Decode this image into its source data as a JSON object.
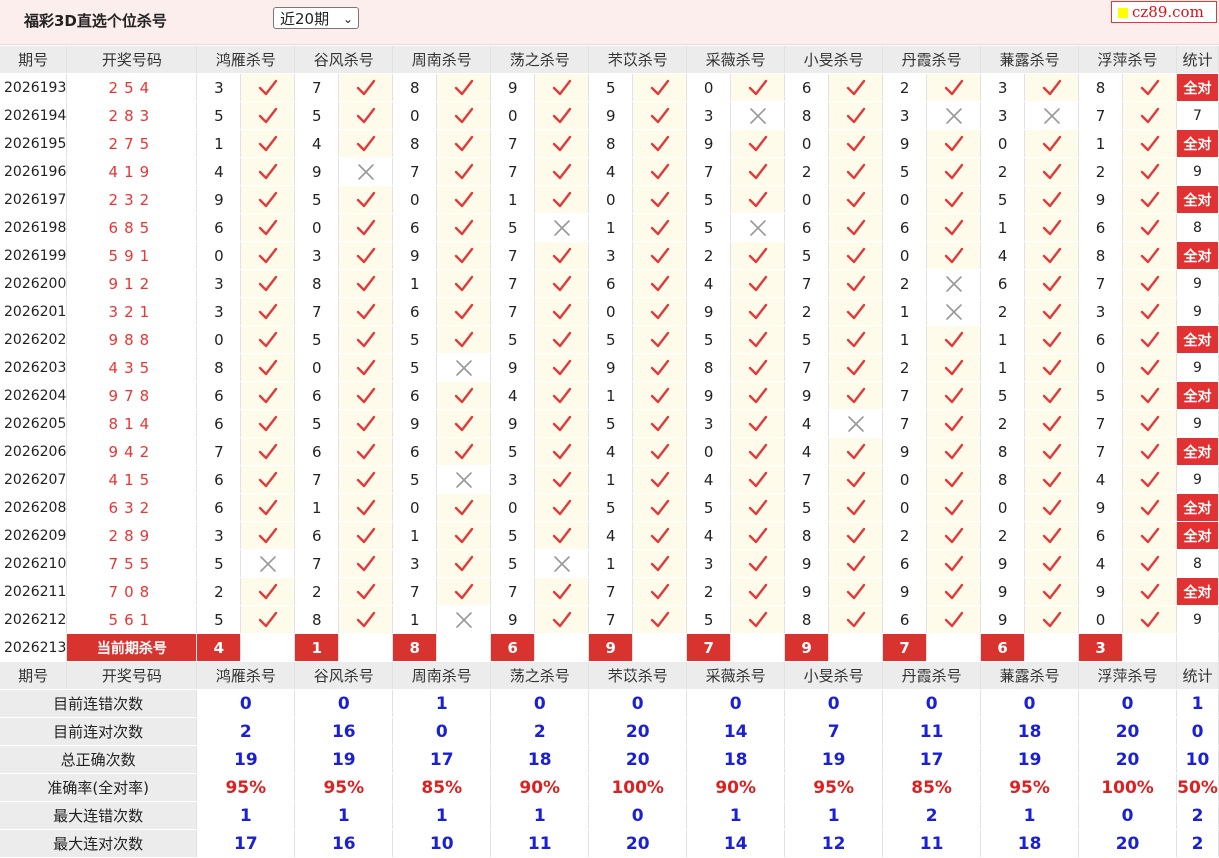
{
  "header": {
    "title": "福彩3D直选个位杀号",
    "period_select": "近20期",
    "logo": "cz89.com"
  },
  "columns": {
    "issue": "期号",
    "draw": "开奖号码",
    "experts": [
      "鸿雁杀号",
      "谷风杀号",
      "周南杀号",
      "荡之杀号",
      "芣苡杀号",
      "采薇杀号",
      "小旻杀号",
      "丹霞杀号",
      "蒹露杀号",
      "浮萍杀号"
    ],
    "stat": "统计"
  },
  "rows": [
    {
      "issue": "2026193",
      "draw": "254",
      "kills": [
        3,
        7,
        8,
        9,
        5,
        0,
        6,
        2,
        3,
        8
      ],
      "hits": [
        1,
        1,
        1,
        1,
        1,
        1,
        1,
        1,
        1,
        1
      ],
      "stat": "全对"
    },
    {
      "issue": "2026194",
      "draw": "283",
      "kills": [
        5,
        5,
        0,
        0,
        9,
        3,
        8,
        3,
        3,
        7
      ],
      "hits": [
        1,
        1,
        1,
        1,
        1,
        0,
        1,
        0,
        0,
        1
      ],
      "stat": "7"
    },
    {
      "issue": "2026195",
      "draw": "275",
      "kills": [
        1,
        4,
        8,
        7,
        8,
        9,
        0,
        9,
        0,
        1
      ],
      "hits": [
        1,
        1,
        1,
        1,
        1,
        1,
        1,
        1,
        1,
        1
      ],
      "stat": "全对"
    },
    {
      "issue": "2026196",
      "draw": "419",
      "kills": [
        4,
        9,
        7,
        7,
        4,
        7,
        2,
        5,
        2,
        2
      ],
      "hits": [
        1,
        0,
        1,
        1,
        1,
        1,
        1,
        1,
        1,
        1
      ],
      "stat": "9"
    },
    {
      "issue": "2026197",
      "draw": "232",
      "kills": [
        9,
        5,
        0,
        1,
        0,
        5,
        0,
        0,
        5,
        9
      ],
      "hits": [
        1,
        1,
        1,
        1,
        1,
        1,
        1,
        1,
        1,
        1
      ],
      "stat": "全对"
    },
    {
      "issue": "2026198",
      "draw": "685",
      "kills": [
        6,
        0,
        6,
        5,
        1,
        5,
        6,
        6,
        1,
        6
      ],
      "hits": [
        1,
        1,
        1,
        0,
        1,
        0,
        1,
        1,
        1,
        1
      ],
      "stat": "8"
    },
    {
      "issue": "2026199",
      "draw": "591",
      "kills": [
        0,
        3,
        9,
        7,
        3,
        2,
        5,
        0,
        4,
        8
      ],
      "hits": [
        1,
        1,
        1,
        1,
        1,
        1,
        1,
        1,
        1,
        1
      ],
      "stat": "全对"
    },
    {
      "issue": "2026200",
      "draw": "912",
      "kills": [
        3,
        8,
        1,
        7,
        6,
        4,
        7,
        2,
        6,
        7
      ],
      "hits": [
        1,
        1,
        1,
        1,
        1,
        1,
        1,
        0,
        1,
        1
      ],
      "stat": "9"
    },
    {
      "issue": "2026201",
      "draw": "321",
      "kills": [
        3,
        7,
        6,
        7,
        0,
        9,
        2,
        1,
        2,
        3
      ],
      "hits": [
        1,
        1,
        1,
        1,
        1,
        1,
        1,
        0,
        1,
        1
      ],
      "stat": "9"
    },
    {
      "issue": "2026202",
      "draw": "988",
      "kills": [
        0,
        5,
        5,
        5,
        5,
        5,
        5,
        1,
        1,
        6
      ],
      "hits": [
        1,
        1,
        1,
        1,
        1,
        1,
        1,
        1,
        1,
        1
      ],
      "stat": "全对"
    },
    {
      "issue": "2026203",
      "draw": "435",
      "kills": [
        8,
        0,
        5,
        9,
        9,
        8,
        7,
        2,
        1,
        0
      ],
      "hits": [
        1,
        1,
        0,
        1,
        1,
        1,
        1,
        1,
        1,
        1
      ],
      "stat": "9"
    },
    {
      "issue": "2026204",
      "draw": "978",
      "kills": [
        6,
        6,
        6,
        4,
        1,
        9,
        9,
        7,
        5,
        5
      ],
      "hits": [
        1,
        1,
        1,
        1,
        1,
        1,
        1,
        1,
        1,
        1
      ],
      "stat": "全对"
    },
    {
      "issue": "2026205",
      "draw": "814",
      "kills": [
        6,
        5,
        9,
        9,
        5,
        3,
        4,
        7,
        2,
        7
      ],
      "hits": [
        1,
        1,
        1,
        1,
        1,
        1,
        0,
        1,
        1,
        1
      ],
      "stat": "9"
    },
    {
      "issue": "2026206",
      "draw": "942",
      "kills": [
        7,
        6,
        6,
        5,
        4,
        0,
        4,
        9,
        8,
        7
      ],
      "hits": [
        1,
        1,
        1,
        1,
        1,
        1,
        1,
        1,
        1,
        1
      ],
      "stat": "全对"
    },
    {
      "issue": "2026207",
      "draw": "415",
      "kills": [
        6,
        7,
        5,
        3,
        1,
        4,
        7,
        0,
        8,
        4
      ],
      "hits": [
        1,
        1,
        0,
        1,
        1,
        1,
        1,
        1,
        1,
        1
      ],
      "stat": "9"
    },
    {
      "issue": "2026208",
      "draw": "632",
      "kills": [
        6,
        1,
        0,
        0,
        5,
        5,
        5,
        0,
        0,
        9
      ],
      "hits": [
        1,
        1,
        1,
        1,
        1,
        1,
        1,
        1,
        1,
        1
      ],
      "stat": "全对"
    },
    {
      "issue": "2026209",
      "draw": "289",
      "kills": [
        3,
        6,
        1,
        5,
        4,
        4,
        8,
        2,
        2,
        6
      ],
      "hits": [
        1,
        1,
        1,
        1,
        1,
        1,
        1,
        1,
        1,
        1
      ],
      "stat": "全对"
    },
    {
      "issue": "2026210",
      "draw": "755",
      "kills": [
        5,
        7,
        3,
        5,
        1,
        3,
        9,
        6,
        9,
        4
      ],
      "hits": [
        0,
        1,
        1,
        0,
        1,
        1,
        1,
        1,
        1,
        1
      ],
      "stat": "8"
    },
    {
      "issue": "2026211",
      "draw": "708",
      "kills": [
        2,
        2,
        7,
        7,
        7,
        2,
        9,
        9,
        9,
        9
      ],
      "hits": [
        1,
        1,
        1,
        1,
        1,
        1,
        1,
        1,
        1,
        1
      ],
      "stat": "全对"
    },
    {
      "issue": "2026212",
      "draw": "561",
      "kills": [
        5,
        8,
        1,
        9,
        7,
        5,
        8,
        6,
        9,
        0
      ],
      "hits": [
        1,
        1,
        0,
        1,
        1,
        1,
        1,
        1,
        1,
        1
      ],
      "stat": "9"
    }
  ],
  "current": {
    "issue": "2026213",
    "label": "当前期杀号",
    "kills": [
      4,
      1,
      8,
      6,
      9,
      7,
      9,
      7,
      6,
      3
    ]
  },
  "stats": [
    {
      "label": "目前连错次数",
      "values": [
        "0",
        "0",
        "1",
        "0",
        "0",
        "0",
        "0",
        "0",
        "0",
        "0"
      ],
      "total": "1",
      "red": false
    },
    {
      "label": "目前连对次数",
      "values": [
        "2",
        "16",
        "0",
        "2",
        "20",
        "14",
        "7",
        "11",
        "18",
        "20"
      ],
      "total": "0",
      "red": false
    },
    {
      "label": "总正确次数",
      "values": [
        "19",
        "19",
        "17",
        "18",
        "20",
        "18",
        "19",
        "17",
        "19",
        "20"
      ],
      "total": "10",
      "red": false
    },
    {
      "label": "准确率(全对率)",
      "values": [
        "95%",
        "95%",
        "85%",
        "90%",
        "100%",
        "90%",
        "95%",
        "85%",
        "95%",
        "100%"
      ],
      "total": "50%",
      "red": true
    },
    {
      "label": "最大连错次数",
      "values": [
        "1",
        "1",
        "1",
        "1",
        "0",
        "1",
        "1",
        "2",
        "1",
        "0"
      ],
      "total": "2",
      "red": false
    },
    {
      "label": "最大连对次数",
      "values": [
        "17",
        "16",
        "10",
        "11",
        "20",
        "14",
        "12",
        "11",
        "18",
        "20"
      ],
      "total": "2",
      "red": false
    }
  ],
  "colors": {
    "accent": "#e03232",
    "stat_blue": "#1a20d8",
    "check": "#e03b3b",
    "cross": "#999999"
  }
}
